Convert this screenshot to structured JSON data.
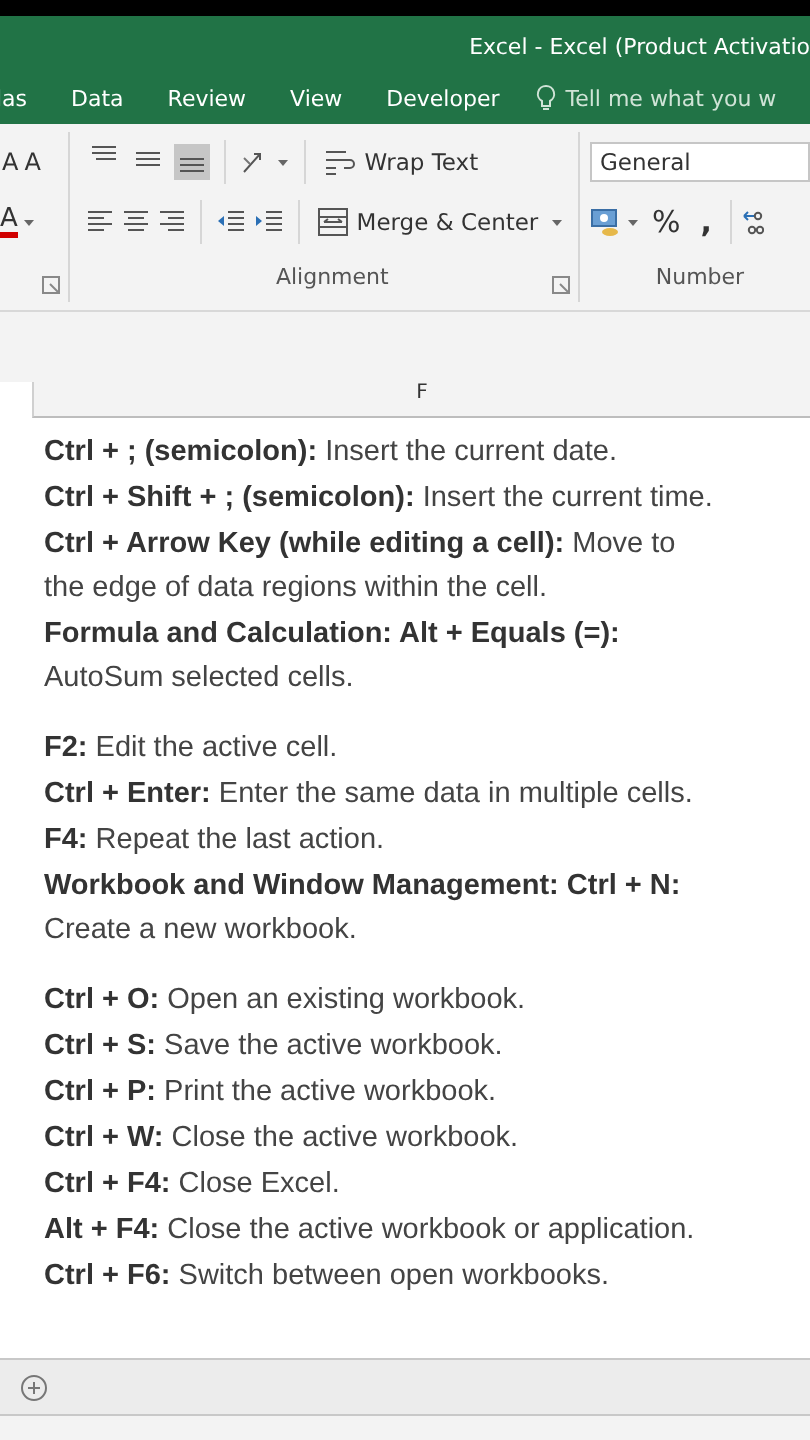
{
  "title_bar": {
    "title": "Excel - Excel (Product Activatio"
  },
  "tabs": [
    {
      "label": "las",
      "selected": false
    },
    {
      "label": "Data",
      "selected": false
    },
    {
      "label": "Review",
      "selected": false
    },
    {
      "label": "View",
      "selected": false
    },
    {
      "label": "Developer",
      "selected": false
    }
  ],
  "tell_me": "Tell me what you w",
  "ribbon": {
    "font": {
      "grow_label": "A",
      "shrink_label": "A",
      "color_label": "A"
    },
    "alignment": {
      "label": "Alignment",
      "vertical_align": [
        {
          "selected": false
        },
        {
          "selected": false
        },
        {
          "selected": true
        }
      ],
      "wrap_text": "Wrap Text",
      "merge_center": "Merge & Center"
    },
    "number": {
      "label": "Number",
      "format": "General",
      "percent": "%",
      "comma": ","
    }
  },
  "column_header": "F",
  "groups": [
    [
      "**Ctrl + ; (semicolon):** Insert the current date.",
      "**Ctrl + Shift + ; (semicolon):** Insert the current time.",
      "**Ctrl + Arrow Key (while editing a cell):** Move to the edge of data regions within the cell.",
      "**Formula and Calculation: Alt + Equals (=):** AutoSum selected cells."
    ],
    [
      "**F2:** Edit the active cell.",
      "**Ctrl + Enter:** Enter the same data in multiple cells.",
      "**F4:** Repeat the last action.",
      "**Workbook and Window Management: Ctrl + N:** Create a new workbook."
    ],
    [
      "**Ctrl + O:** Open an existing workbook.",
      "**Ctrl + S:** Save the active workbook.",
      "**Ctrl + P:** Print the active workbook.",
      "**Ctrl + W:** Close the active workbook.",
      "**Ctrl + F4:** Close Excel.",
      "**Alt + F4:** Close the active workbook or application.",
      "**Ctrl + F6:** Switch between open workbooks."
    ]
  ]
}
